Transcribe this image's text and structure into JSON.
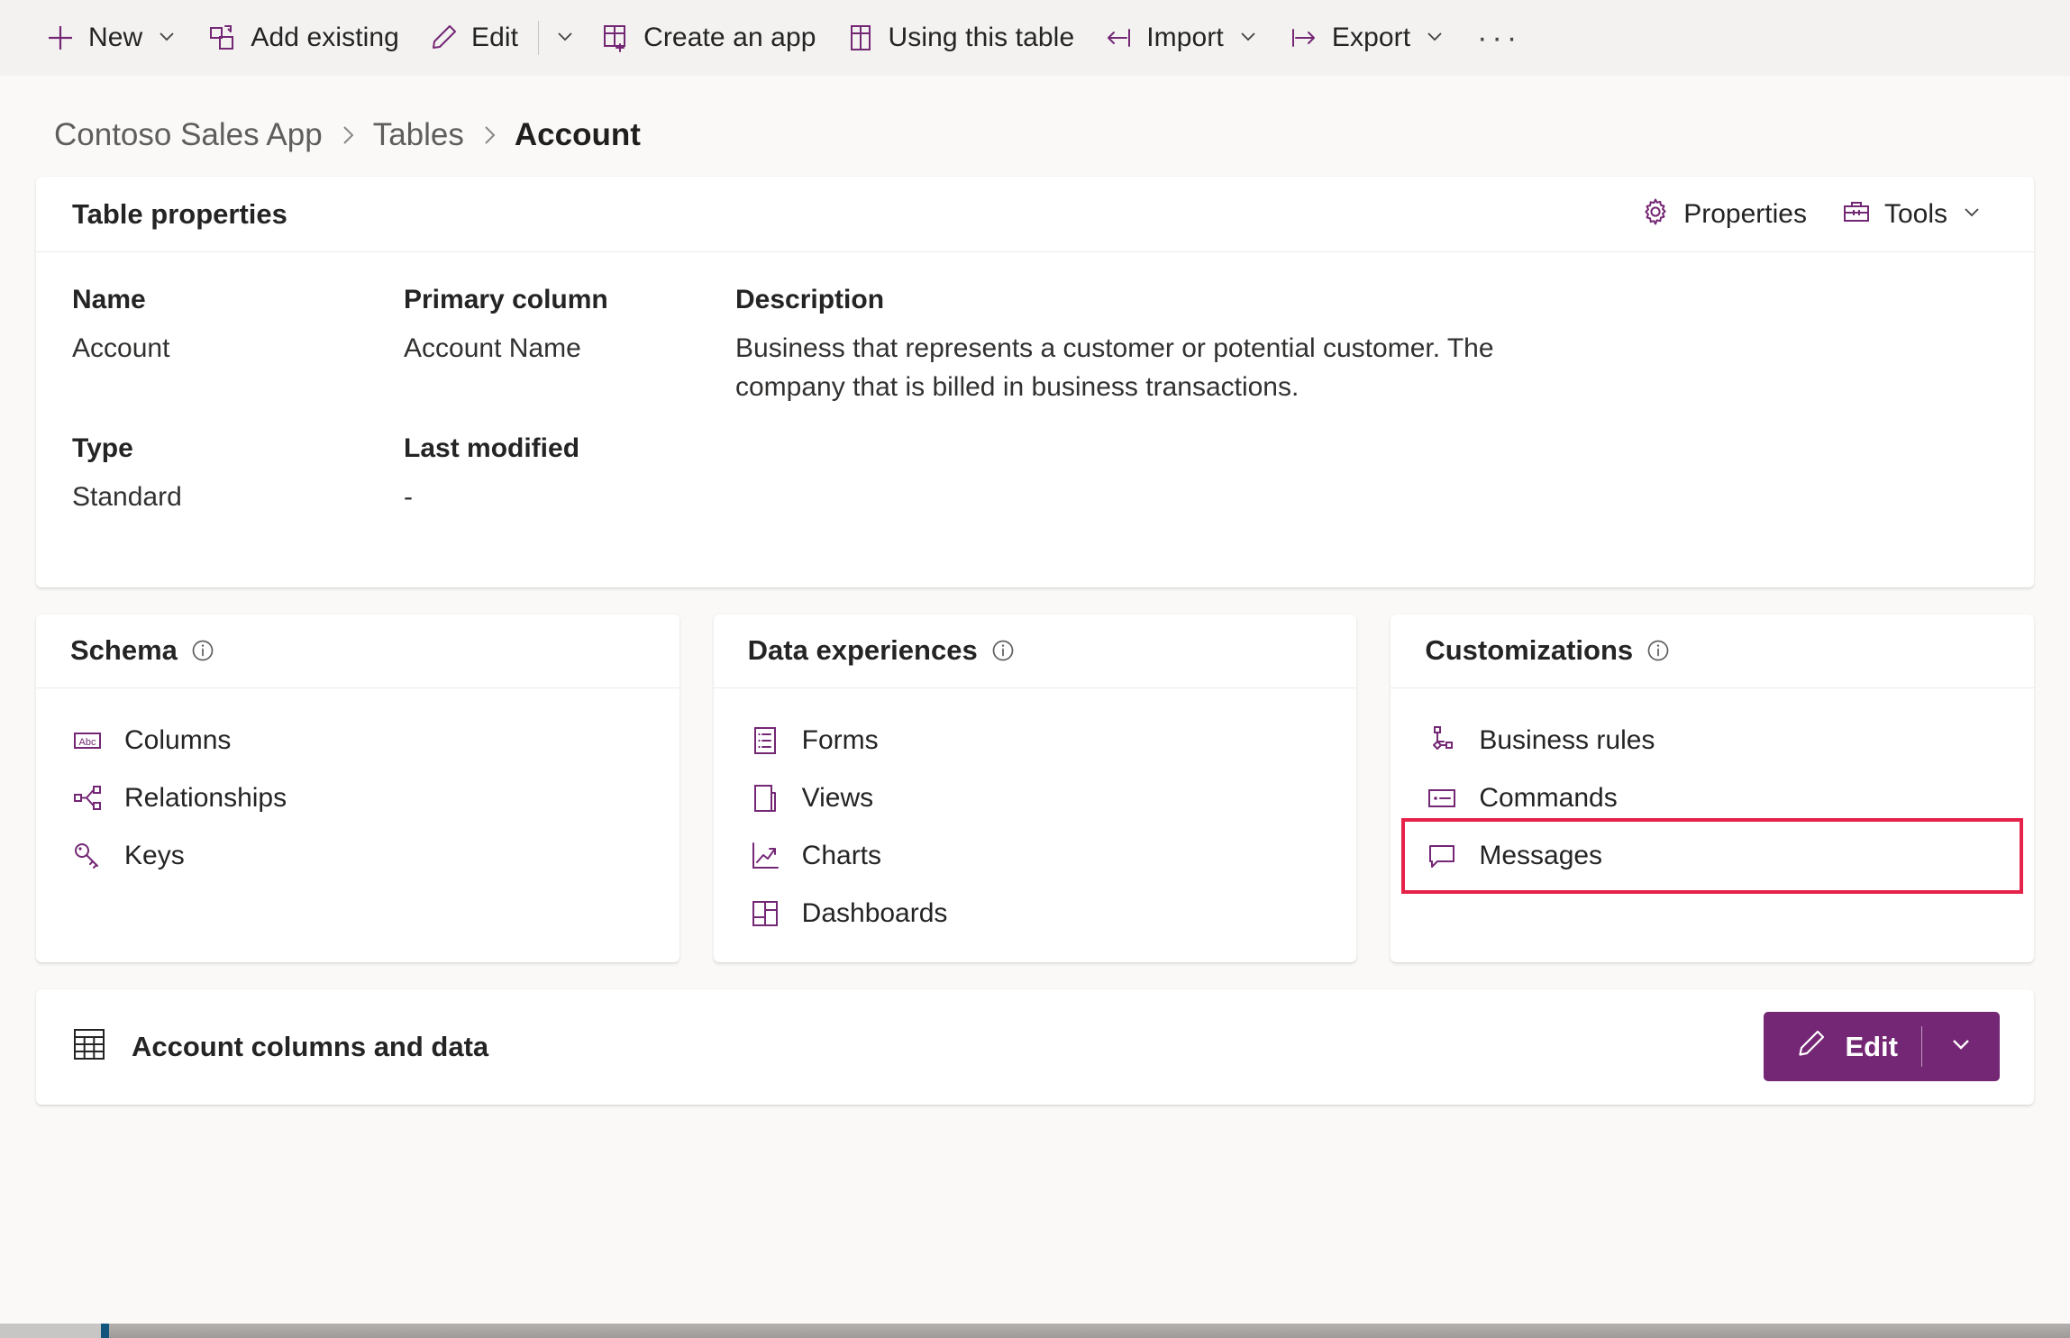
{
  "command_bar": {
    "items": [
      {
        "label": "New",
        "icon": "plus-icon",
        "has_chevron": true
      },
      {
        "label": "Add existing",
        "icon": "add-existing-icon",
        "has_chevron": false
      },
      {
        "label": "Edit",
        "icon": "pencil-icon",
        "has_chevron": true
      },
      {
        "label": "Create an app",
        "icon": "create-app-icon",
        "has_chevron": false
      },
      {
        "label": "Using this table",
        "icon": "using-table-icon",
        "has_chevron": false
      },
      {
        "label": "Import",
        "icon": "import-icon",
        "has_chevron": true
      },
      {
        "label": "Export",
        "icon": "export-icon",
        "has_chevron": true
      }
    ],
    "overflow_label": "···"
  },
  "breadcrumb": {
    "items": [
      {
        "label": "Contoso Sales App",
        "current": false
      },
      {
        "label": "Tables",
        "current": false
      },
      {
        "label": "Account",
        "current": true
      }
    ]
  },
  "table_properties": {
    "title": "Table properties",
    "actions": [
      {
        "label": "Properties",
        "icon": "gear-icon",
        "has_chevron": false
      },
      {
        "label": "Tools",
        "icon": "toolbox-icon",
        "has_chevron": true
      }
    ],
    "fields": {
      "name_label": "Name",
      "name_value": "Account",
      "type_label": "Type",
      "type_value": "Standard",
      "primary_column_label": "Primary column",
      "primary_column_value": "Account Name",
      "last_modified_label": "Last modified",
      "last_modified_value": "-",
      "description_label": "Description",
      "description_value": "Business that represents a customer or potential customer. The company that is billed in business transactions."
    }
  },
  "cards": [
    {
      "title": "Schema",
      "info_icon": "info-icon",
      "items": [
        {
          "label": "Columns",
          "icon": "abc-icon"
        },
        {
          "label": "Relationships",
          "icon": "relationships-icon"
        },
        {
          "label": "Keys",
          "icon": "key-icon"
        }
      ]
    },
    {
      "title": "Data experiences",
      "info_icon": "info-icon",
      "items": [
        {
          "label": "Forms",
          "icon": "form-icon"
        },
        {
          "label": "Views",
          "icon": "view-icon"
        },
        {
          "label": "Charts",
          "icon": "chart-icon"
        },
        {
          "label": "Dashboards",
          "icon": "dashboard-icon"
        }
      ]
    },
    {
      "title": "Customizations",
      "info_icon": "info-icon",
      "items": [
        {
          "label": "Business rules",
          "icon": "business-rules-icon",
          "highlighted": false
        },
        {
          "label": "Commands",
          "icon": "commands-icon",
          "highlighted": false
        },
        {
          "label": "Messages",
          "icon": "message-icon",
          "highlighted": true
        }
      ]
    }
  ],
  "data_section": {
    "title": "Account columns and data",
    "icon": "table-grid-icon",
    "edit_button": {
      "label": "Edit",
      "icon": "pencil-icon"
    }
  },
  "colors": {
    "accent_purple": "#742774",
    "highlight_red": "#e6224a",
    "page_background": "#faf9f8",
    "command_bar_background": "#f3f2f1",
    "card_background": "#ffffff"
  }
}
